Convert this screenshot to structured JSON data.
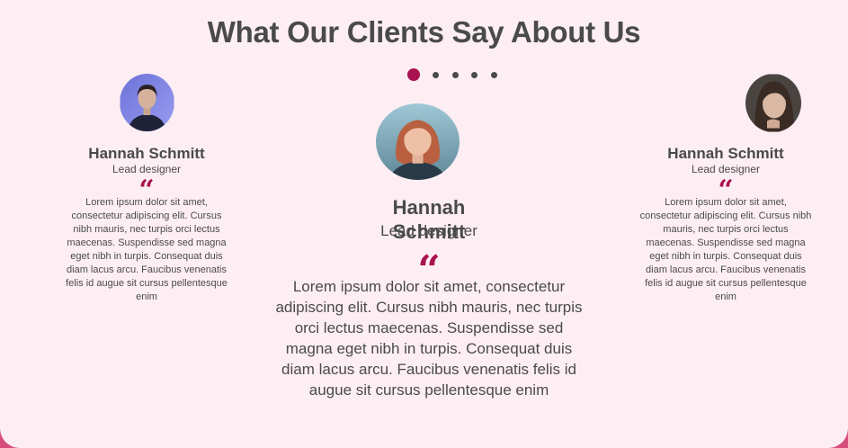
{
  "header": {
    "title": "What Our Clients Say About Us"
  },
  "carousel": {
    "dot_count": 5,
    "active_index": 0
  },
  "colors": {
    "accent": "#a8134f",
    "background": "#fdeef4",
    "text": "#4a4a4a",
    "border": "#d64c7c"
  },
  "testimonials": [
    {
      "name": "Hannah Schmitt",
      "role": "Lead designer",
      "quote_mark": "“",
      "text": "Lorem ipsum dolor sit amet, consectetur adipiscing elit. Cursus nibh mauris, nec turpis orci lectus maecenas. Suspendisse sed magna eget nibh in turpis. Consequat duis diam lacus arcu. Faucibus venenatis felis id augue sit cursus pellentesque enim"
    },
    {
      "name": "Hannah Schmitt",
      "role": "Lead designer",
      "quote_mark": "“",
      "text": "Lorem ipsum dolor sit amet, consectetur adipiscing elit. Cursus nibh mauris, nec turpis orci lectus maecenas. Suspendisse sed magna eget nibh in turpis. Consequat duis diam lacus arcu. Faucibus venenatis felis id augue sit cursus pellentesque enim"
    },
    {
      "name": "Hannah Schmitt",
      "role": "Lead designer",
      "quote_mark": "“",
      "text": "Lorem ipsum dolor sit amet, consectetur adipiscing elit. Cursus nibh mauris, nec turpis orci lectus maecenas. Suspendisse sed magna eget nibh in turpis. Consequat duis diam lacus arcu. Faucibus venenatis felis id augue sit cursus pellentesque enim"
    }
  ]
}
